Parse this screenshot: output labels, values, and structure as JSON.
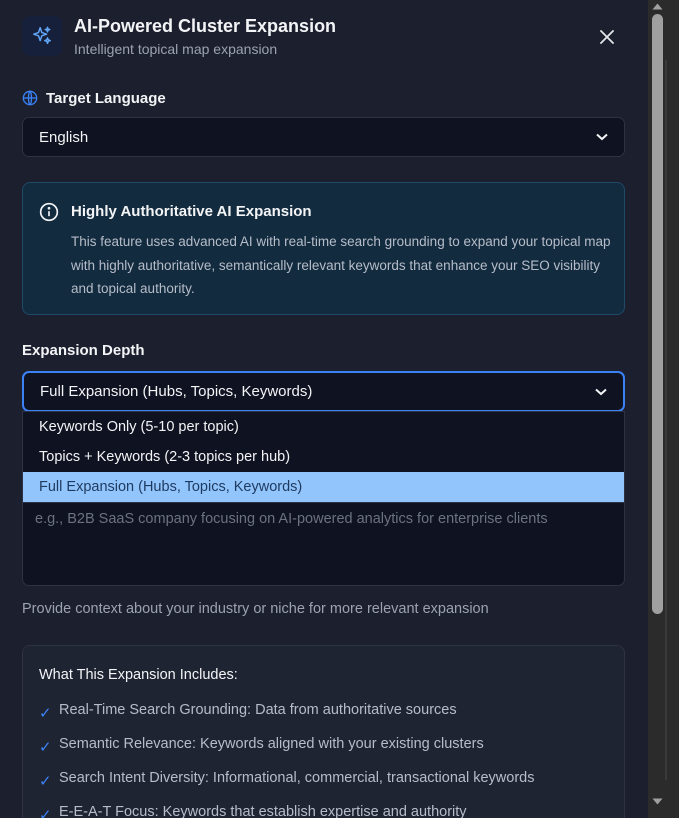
{
  "header": {
    "title": "AI-Powered Cluster Expansion",
    "subtitle": "Intelligent topical map expansion",
    "icon": "sparkles-icon",
    "close_icon": "close-icon"
  },
  "language": {
    "label": "Target Language",
    "icon": "globe-icon",
    "selected": "English"
  },
  "info": {
    "title": "Highly Authoritative AI Expansion",
    "text": "This feature uses advanced AI with real-time search grounding to expand your topical map with highly authoritative, semantically relevant keywords that enhance your SEO visibility and topical authority.",
    "icon": "info-icon"
  },
  "depth": {
    "label": "Expansion Depth",
    "selected": "Full Expansion (Hubs, Topics, Keywords)",
    "options": [
      "Keywords Only (5-10 per topic)",
      "Topics + Keywords (2-3 topics per hub)",
      "Full Expansion (Hubs, Topics, Keywords)"
    ]
  },
  "context": {
    "placeholder": "e.g., B2B SaaS company focusing on AI-powered analytics for enterprise clients",
    "help": "Provide context about your industry or niche for more relevant expansion"
  },
  "includes": {
    "title": "What This Expansion Includes:",
    "items": [
      "Real-Time Search Grounding: Data from authoritative sources",
      "Semantic Relevance: Keywords aligned with your existing clusters",
      "Search Intent Diversity: Informational, commercial, transactional keywords",
      "E-E-A-T Focus: Keywords that establish expertise and authority"
    ]
  },
  "colors": {
    "accent": "#3b82f6",
    "background": "#1b1f2e",
    "info_bg": "#132b3f",
    "selected_option": "#93c5fd"
  }
}
